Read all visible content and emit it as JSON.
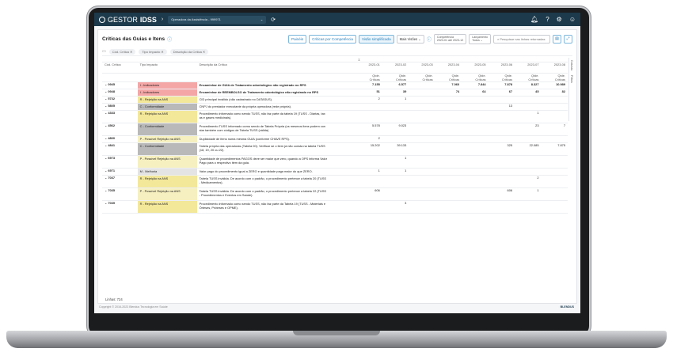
{
  "app": {
    "brand_light": "GESTOR",
    "brand_bold": "IDSS",
    "operator": "Operadora da Assistência - 999971"
  },
  "page": {
    "title": "Críticas das Guias e Itens"
  },
  "toolbar": {
    "tabs": [
      "Painéis",
      "Críticas por Competência",
      "Visão simplificada"
    ],
    "view_select": "Mais Visões",
    "competencia_label": "Competência",
    "competencia_value": "2023-01 até 2023-12",
    "lancamento_label": "Lançamento",
    "lancamento_value": "Todos",
    "search_placeholder": "Pesquisar nas linhas retornadas"
  },
  "groups": [
    "Cód. Crítica",
    "Tipo Impacto",
    "Descrição da Crítica"
  ],
  "columns": {
    "cod": "Cód. Crítica",
    "tipo": "Tipo Impacto",
    "desc": "Descrição da Crítica",
    "sum": "Σ",
    "months": [
      "2023-01",
      "2023-02",
      "2023-03",
      "2023-04",
      "2023-05",
      "2023-06",
      "2023-07",
      "2023-08"
    ],
    "sub1": "Qtde.",
    "sub2": "Críticas"
  },
  "rows": [
    {
      "cod": "0945",
      "tipo": "I - Indicadores",
      "color": "#f4a6a6",
      "bold": true,
      "desc": [
        "Encaminhar de GUIA de Tratamento odontológico não registrado no RPS"
      ],
      "v": [
        "7.155",
        "6.577",
        "",
        "7.060",
        "7.844",
        "7.878",
        "8.327",
        "8.332"
      ],
      "last": "10.989"
    },
    {
      "cod": "0948",
      "tipo": "I - Indicadores",
      "color": "#f4a6a6",
      "bold": true,
      "desc": [
        "Encaminhar de REEMBOLSO de Tratamento odontológico não registrado no RPS"
      ],
      "v": [
        "51",
        "39",
        "",
        "74",
        "64",
        "67",
        "45",
        "58"
      ],
      "last": "82"
    },
    {
      "cod": "5732",
      "tipo": "R - Rejeição na ANS",
      "color": "#f3e79a",
      "bold": false,
      "desc": [
        "CID principal inválido (não cadastrado no DATASUS)."
      ],
      "v": [
        "2",
        "1",
        "",
        "",
        "",
        "",
        "",
        ""
      ],
      "last": ""
    },
    {
      "cod": "5805",
      "tipo": "C - Conformidade",
      "color": "#b9b9b9",
      "bold": false,
      "desc": [
        "CNPJ do prestador executante da própria operadora (rede própria)."
      ],
      "v": [
        "",
        "",
        "",
        "",
        "",
        "13",
        "",
        ""
      ],
      "last": ""
    },
    {
      "cod": "4333",
      "tipo": "R - Rejeição na ANS",
      "color": "#f3e79a",
      "bold": false,
      "desc": [
        "Procedimento informado como sendo TUSS, não faz parte da tabela 19 (TUSS - Diárias, tax",
        "as e gases medicinais)."
      ],
      "v": [
        "",
        "",
        "",
        "",
        "",
        "",
        "1",
        ""
      ],
      "last": ""
    },
    {
      "cod": "4562",
      "tipo": "C - Conformidade",
      "color": "#b9b9b9",
      "bold": false,
      "desc": [
        "Procedimento TUSS informado como sendo de Tabela Própria (os mesmos itens podem con",
        "star também com códigos de Tabela TUSS (válida)"
      ],
      "v": [
        "5.578",
        "9.023",
        "",
        "",
        "",
        "",
        "23",
        "3"
      ],
      "last": "7"
    },
    {
      "cod": "4800",
      "tipo": "P - Possível Rejeição na ANS",
      "color": "#f6f0c0",
      "bold": false,
      "desc": [
        "Duplicidade de itens numa mesma GUIA (conforme CHAVE RPS)."
      ],
      "v": [
        "2",
        "",
        "",
        "",
        "",
        "",
        "",
        ""
      ],
      "last": ""
    },
    {
      "cod": "4841",
      "tipo": "C - Conformidade",
      "color": "#b9b9b9",
      "bold": false,
      "desc": [
        "Tabela própria das operadoras (Tabela 00). Verificar se o item já não consta na tabela TUSS",
        "(18, 19, 20 ou 22)."
      ],
      "v": [
        "15.202",
        "39.133",
        "",
        "",
        "",
        "325",
        "22.085",
        "7.134"
      ],
      "last": "7.875"
    },
    {
      "cod": "6973",
      "tipo": "P - Possível Rejeição na ANS",
      "color": "#f6f0c0",
      "bold": false,
      "desc": [
        "Quantidade de procedimentos PAGOS deve ser maior que zero, quando a OPS informa Valor",
        "Pago para o respectivo item da guia."
      ],
      "v": [
        "",
        "1",
        "",
        "",
        "",
        "",
        "",
        ""
      ],
      "last": ""
    },
    {
      "cod": "6971",
      "tipo": "M - Melhoria",
      "color": "#e4e4e4",
      "bold": false,
      "desc": [
        "Valor pago do procedimento igual a ZERO e quantidade paga maior do que ZERO."
      ],
      "v": [
        "1",
        "1",
        "",
        "",
        "",
        "",
        "",
        ""
      ],
      "last": ""
    },
    {
      "cod": "7037",
      "tipo": "R - Rejeição na ANS",
      "color": "#f3e79a",
      "bold": false,
      "desc": [
        "Tabela TUSS inválida. De acordo com o padrão, o procedimento pertence a tabela 20 (TUSS",
        "- Medicamentos)."
      ],
      "v": [
        "",
        "",
        "",
        "",
        "",
        "",
        "2",
        ""
      ],
      "last": ""
    },
    {
      "cod": "7035",
      "tipo": "P - Possível Rejeição na ANS",
      "color": "#f6f0c0",
      "bold": false,
      "desc": [
        "Tabela TUSS inválida. De acordo com o padrão, o procedimento pertence a tabela 22 (TUSS",
        "- Procedimentos e Eventos em Saúde)."
      ],
      "v": [
        "606",
        "",
        "",
        "",
        "",
        "606",
        "1",
        ""
      ],
      "last": ""
    },
    {
      "cod": "7039",
      "tipo": "R - Rejeição na ANS",
      "color": "#f3e79a",
      "bold": false,
      "desc": [
        "Procedimento informado como sendo TUSS, não faz parte da Tabela 19 (TUSS - Materiais e",
        "Órteses, Próteses e OPME)."
      ],
      "v": [
        "",
        "3",
        "",
        "",
        "",
        "",
        "",
        ""
      ],
      "last": ""
    }
  ],
  "linhas": "Linhas: 724",
  "side_tabs": [
    "Colunas",
    "Filtros"
  ],
  "footer": {
    "copyright": "Copyright © 2016-2023 Blendus Tecnologia em Saúde",
    "brand": "BLENDUS"
  }
}
